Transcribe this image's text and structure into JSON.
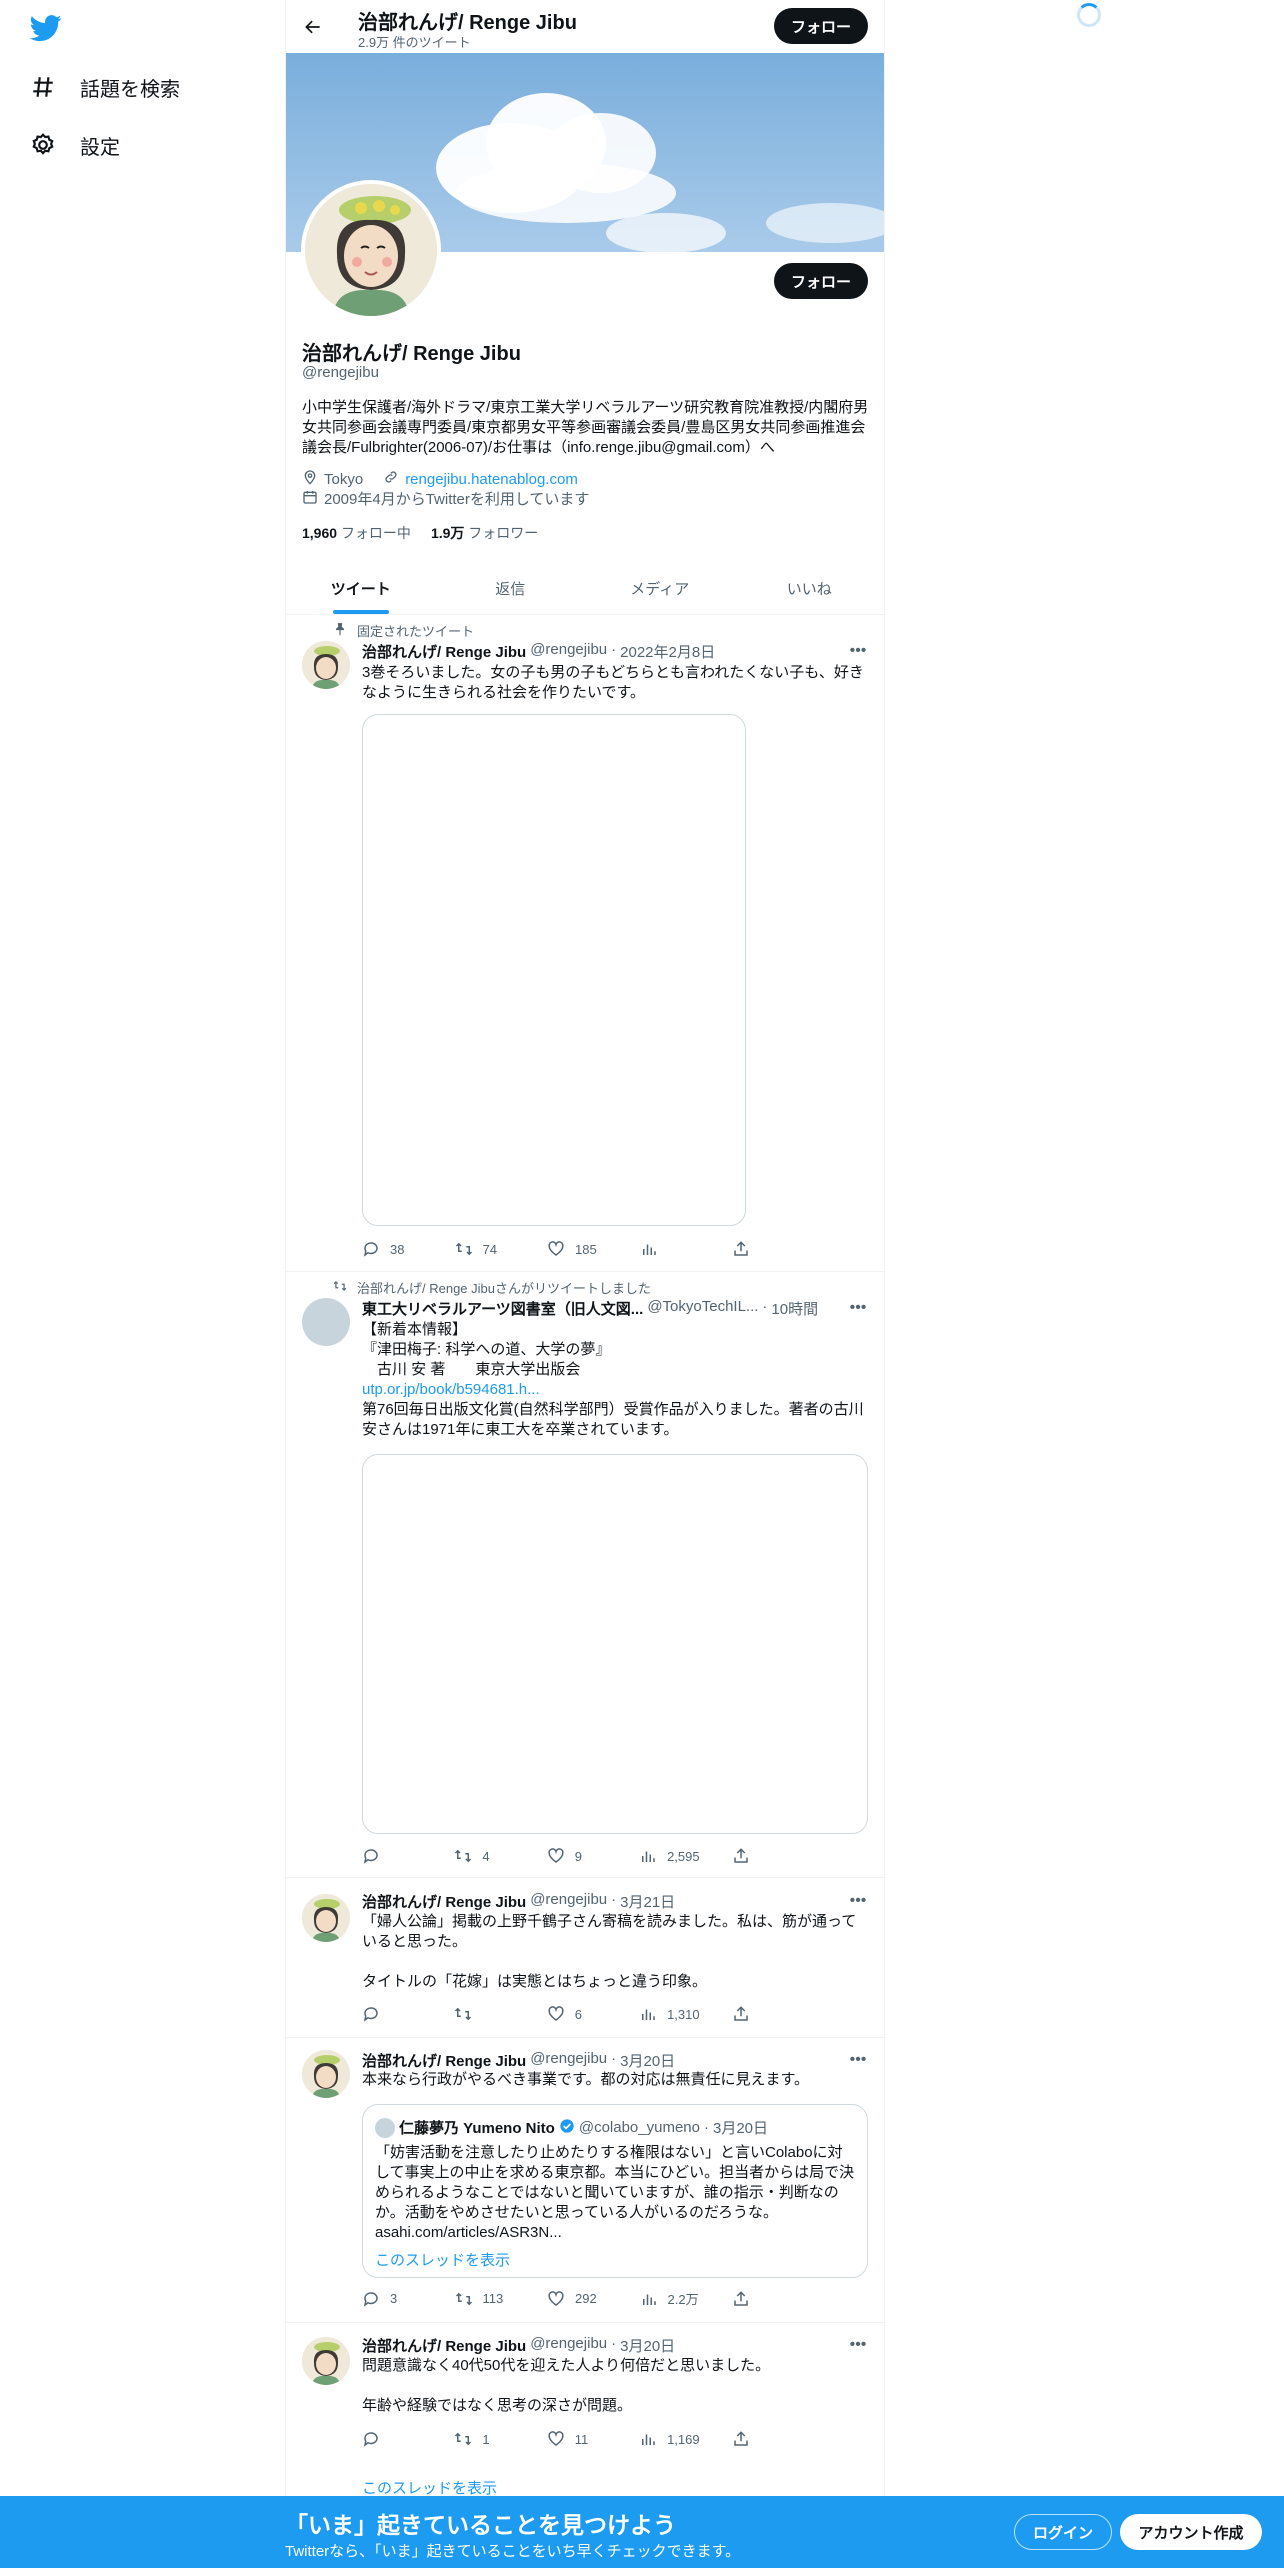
{
  "sidebar": {
    "items": [
      {
        "label": "話題を検索",
        "icon": "hashtag-icon"
      },
      {
        "label": "設定",
        "icon": "gear-icon"
      }
    ]
  },
  "header": {
    "name": "治部れんげ/ Renge Jibu",
    "tweet_count": "2.9万 件のツイート",
    "follow_label": "フォロー"
  },
  "profile": {
    "name": "治部れんげ/ Renge Jibu",
    "handle": "@rengejibu",
    "follow_label": "フォロー",
    "bio": "小中学生保護者/海外ドラマ/東京工業大学リベラルアーツ研究教育院准教授/内閣府男女共同参画会議専門委員/東京都男女平等参画審議会委員/豊島区男女共同参画推進会議会長/Fulbrighter(2006-07)/お仕事は（info.renge.jibu@gmail.com）へ",
    "location": "Tokyo",
    "website": "rengejibu.hatenablog.com",
    "joined": "2009年4月からTwitterを利用しています",
    "following_count": "1,960",
    "following_label": "フォロー中",
    "followers_count": "1.9万",
    "followers_label": "フォロワー"
  },
  "tabs": [
    "ツイート",
    "返信",
    "メディア",
    "いいね"
  ],
  "tweets": [
    {
      "context": "固定されたツイート",
      "name": "治部れんげ/ Renge Jibu",
      "handle": "@rengejibu",
      "date": "2022年2月8日",
      "lines": [
        "3巻そろいました。女の子も男の子もどちらとも言われたくない子も、好き",
        "なように生きられる社会を作りたいです。"
      ],
      "replies": "38",
      "retweets": "74",
      "likes": "185",
      "views": ""
    },
    {
      "context": "治部れんげ/ Renge Jibuさんがリツイートしました",
      "name": "東工大リベラルアーツ図書室（旧人文図...",
      "handle": "@TokyoTechIL...",
      "date": "10時間",
      "lines": [
        "【新着本情報】",
        "『津田梅子: 科学への道、大学の夢』",
        "　古川 安 著　　東京大学出版会"
      ],
      "link": "utp.or.jp/book/b594681.h...",
      "lines2": [
        "第76回毎日出版文化賞(自然科学部門）受賞作品が入りました。著者の古川",
        "安さんは1971年に東工大を卒業されています。"
      ],
      "replies": "",
      "retweets": "4",
      "likes": "9",
      "views": "2,595"
    },
    {
      "name": "治部れんげ/ Renge Jibu",
      "handle": "@rengejibu",
      "date": "3月21日",
      "lines": [
        "「婦人公論」掲載の上野千鶴子さん寄稿を読みました。私は、筋が通って",
        "いると思った。",
        " ",
        "タイトルの「花嫁」は実態とはちょっと違う印象。"
      ],
      "replies": "",
      "retweets": "",
      "likes": "6",
      "views": "1,310"
    },
    {
      "name": "治部れんげ/ Renge Jibu",
      "handle": "@rengejibu",
      "date": "3月20日",
      "lines": [
        "本来なら行政がやるべき事業です。都の対応は無責任に見えます。"
      ],
      "quote": {
        "name": "仁藤夢乃 Yumeno Nito",
        "handle": "@colabo_yumeno",
        "date": "3月20日",
        "lines": [
          "「妨害活動を注意したり止めたりする権限はない」と言いColaboに対",
          "して事実上の中止を求める東京都。本当にひどい。担当者からは局で決",
          "められるようなことではないと聞いていますが、誰の指示・判断なの",
          "か。活動をやめさせたいと思っている人がいるのだろうな。",
          "asahi.com/articles/ASR3N..."
        ],
        "show_thread": "このスレッドを表示"
      },
      "replies": "3",
      "retweets": "113",
      "likes": "292",
      "views": "2.2万"
    },
    {
      "name": "治部れんげ/ Renge Jibu",
      "handle": "@rengejibu",
      "date": "3月20日",
      "lines": [
        "問題意識なく40代50代を迎えた人より何倍だと思いました。",
        " ",
        "年齢や経験ではなく思考の深さが問題。"
      ],
      "replies": "",
      "retweets": "1",
      "likes": "11",
      "views": "1,169",
      "show_thread": "このスレッドを表示"
    }
  ],
  "bottom_bar": {
    "title": "「いま」起きていることを見つけよう",
    "subtitle": "Twitterなら、「いま」起きていることをいち早くチェックできます。",
    "login": "ログイン",
    "signup": "アカウント作成"
  },
  "colors": {
    "accent": "#1d9bf0",
    "text": "#0f1419",
    "muted": "#536471",
    "border": "#eff3f4"
  }
}
